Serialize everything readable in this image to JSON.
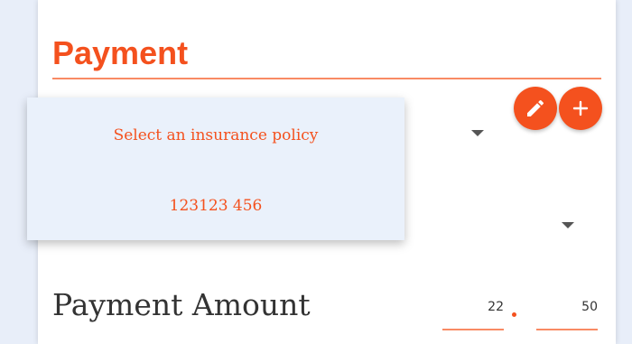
{
  "header": {
    "title": "Payment"
  },
  "actions": {
    "edit_icon": "pencil-icon",
    "add_icon": "plus-icon"
  },
  "dropdown": {
    "options": [
      "Select an insurance policy",
      "123123 456"
    ]
  },
  "payment_amount": {
    "label": "Payment Amount",
    "whole": "22",
    "cents": "50"
  },
  "colors": {
    "accent": "#f4511e",
    "underline": "#f98a64",
    "dropdown_bg": "#eaf1fb",
    "page_bg": "#e8eef9"
  }
}
